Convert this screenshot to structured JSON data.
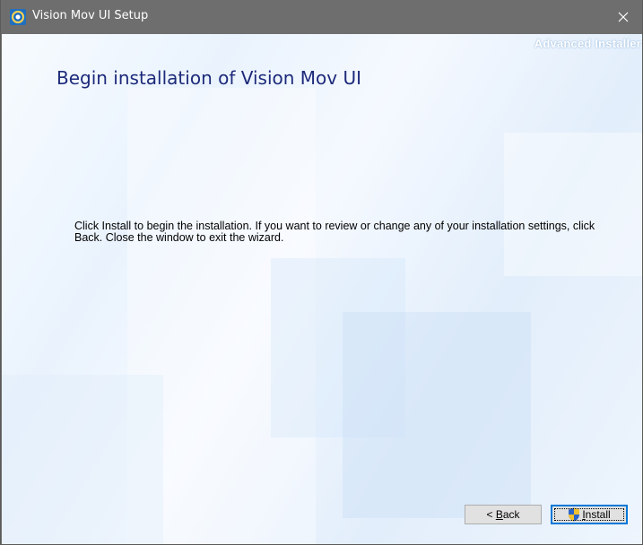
{
  "window": {
    "title": "Vision Mov UI Setup",
    "close_glyph": "✕"
  },
  "brand": "Advanced Installer",
  "content": {
    "heading": "Begin installation of Vision Mov UI",
    "body": "Click Install to begin the installation.  If you want to review or change any of your installation settings, click Back.  Close the window to exit the wizard."
  },
  "buttons": {
    "back": {
      "prefix": "< ",
      "mnemonic": "B",
      "rest": "ack"
    },
    "install": {
      "mnemonic": "I",
      "rest": "nstall",
      "icon": "uac-shield-icon"
    }
  },
  "colors": {
    "titlebar": "#6e6e6e",
    "heading": "#1d2a7a",
    "focus_border": "#0078d7"
  }
}
